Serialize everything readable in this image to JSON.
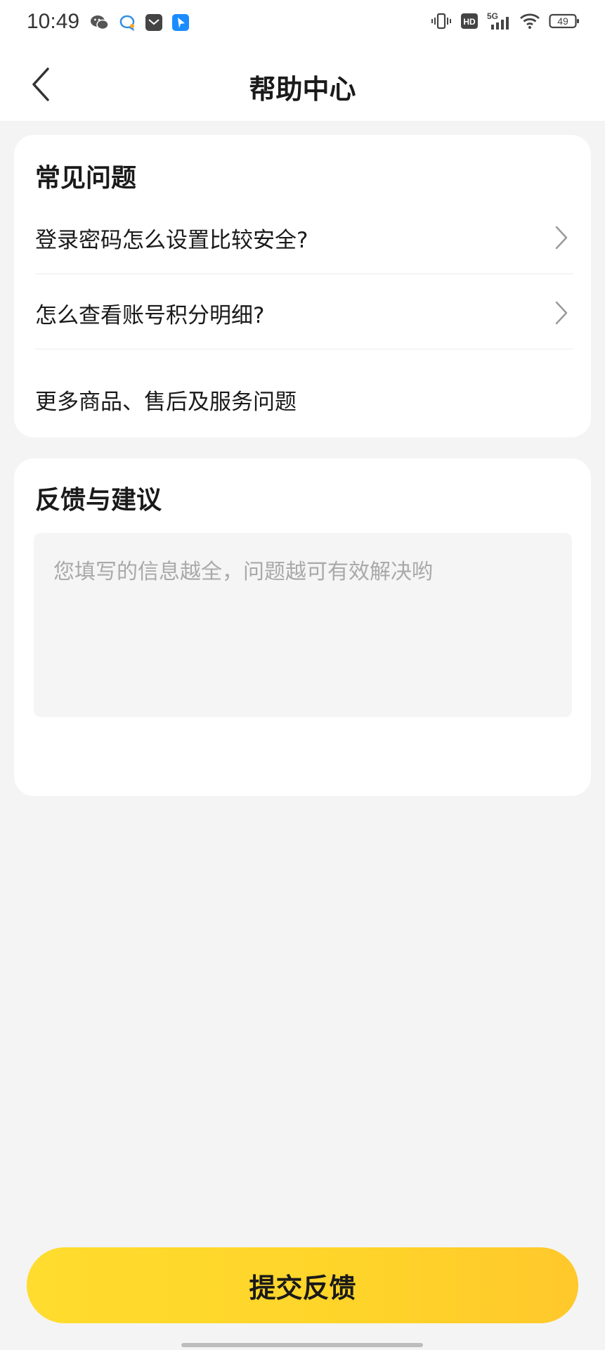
{
  "status_bar": {
    "time": "10:49",
    "network": "5G",
    "hd_label": "HD",
    "battery": "49",
    "left_icons": [
      "wechat-icon",
      "chat-bubble-icon",
      "mail-app-icon",
      "blue-app-icon"
    ],
    "right_icons": [
      "vibrate-icon",
      "hd-icon",
      "signal-icon",
      "wifi-icon",
      "battery-icon"
    ]
  },
  "header": {
    "title": "帮助中心",
    "back_icon": "chevron-left-icon"
  },
  "faq": {
    "title": "常见问题",
    "items": [
      {
        "label": "登录密码怎么设置比较安全?",
        "icon": "chevron-right-icon"
      },
      {
        "label": "怎么查看账号积分明细?",
        "icon": "chevron-right-icon"
      }
    ],
    "more_label": "更多商品、售后及服务问题"
  },
  "feedback": {
    "title": "反馈与建议",
    "placeholder": "您填写的信息越全，问题越可有效解决哟",
    "value": ""
  },
  "submit": {
    "label": "提交反馈"
  },
  "colors": {
    "accent": "#FFD42A",
    "background": "#F4F4F4",
    "card": "#FFFFFF",
    "input_bg": "#F5F5F5",
    "placeholder": "#A9A9A9"
  }
}
